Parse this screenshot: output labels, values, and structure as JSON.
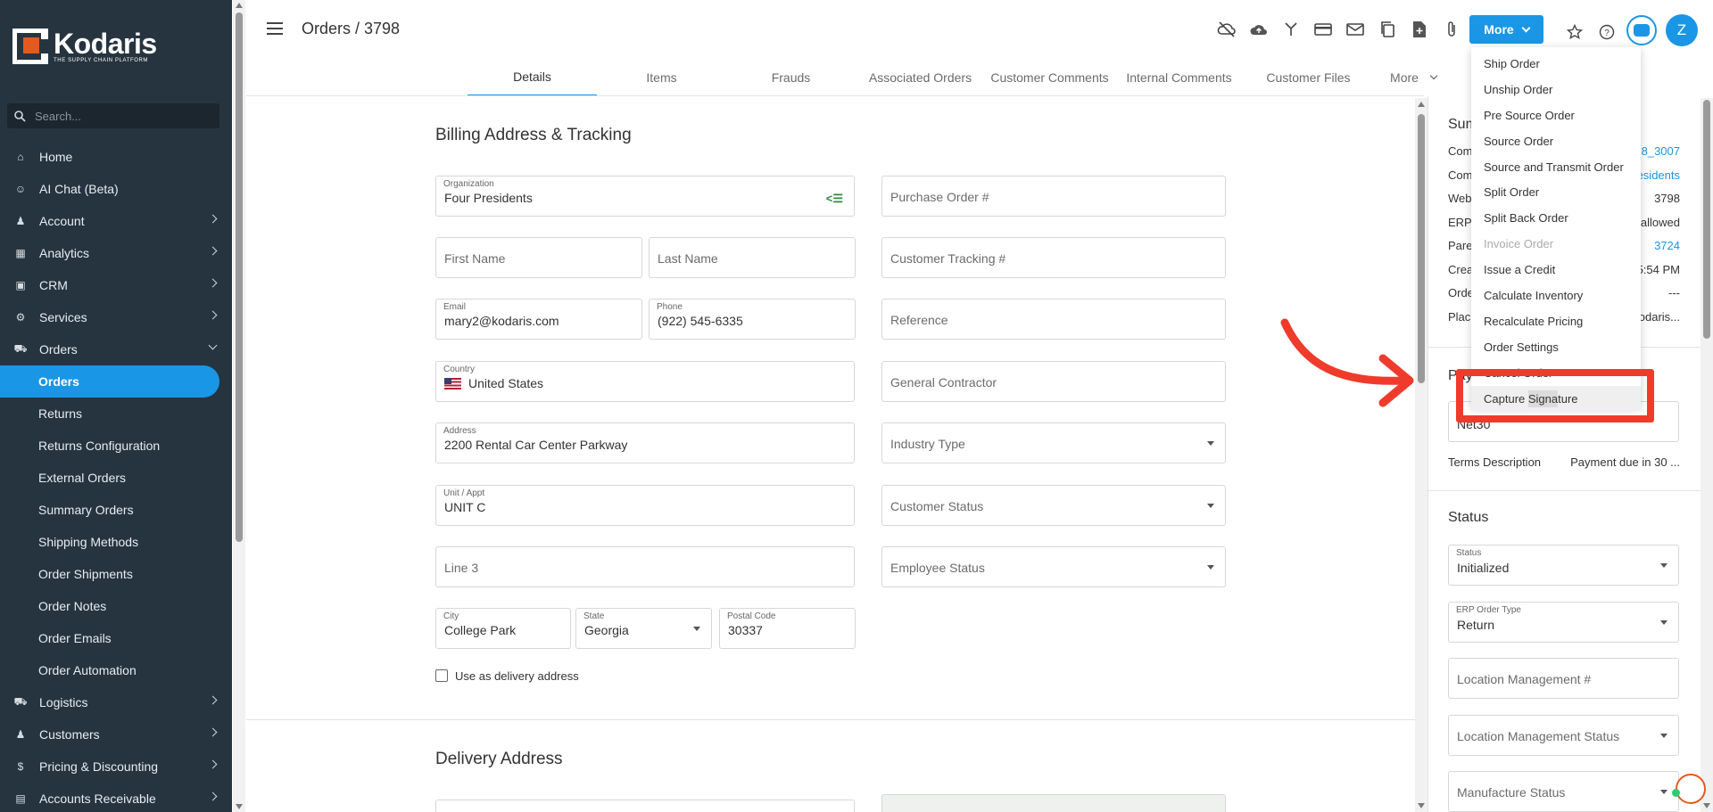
{
  "app": {
    "logo_name": "Kodaris",
    "logo_tagline": "THE SUPPLY CHAIN PLATFORM",
    "search_placeholder": "Search..."
  },
  "sidebar": {
    "items": [
      {
        "label": "Home",
        "icon": "home-icon",
        "glyph": "⌂"
      },
      {
        "label": "AI Chat (Beta)",
        "icon": "robot-icon",
        "glyph": "☺"
      },
      {
        "label": "Account",
        "icon": "person-icon",
        "glyph": "♟"
      },
      {
        "label": "Analytics",
        "icon": "chart-icon",
        "glyph": "▦"
      },
      {
        "label": "CRM",
        "icon": "contact-card-icon",
        "glyph": "▣"
      },
      {
        "label": "Services",
        "icon": "gears-icon",
        "glyph": "⚙"
      },
      {
        "label": "Orders",
        "icon": "truck-icon",
        "glyph": "⛟"
      }
    ],
    "orders_sub": [
      "Orders",
      "Returns",
      "Returns Configuration",
      "External Orders",
      "Summary Orders",
      "Shipping Methods",
      "Order Shipments",
      "Order Notes",
      "Order Emails",
      "Order Automation"
    ],
    "items_after": [
      {
        "label": "Logistics",
        "icon": "truck-fast-icon",
        "glyph": "⛟"
      },
      {
        "label": "Customers",
        "icon": "people-icon",
        "glyph": "♟"
      },
      {
        "label": "Pricing & Discounting",
        "icon": "dollar-icon",
        "glyph": "$"
      },
      {
        "label": "Accounts Receivable",
        "icon": "receivable-icon",
        "glyph": "▤"
      }
    ]
  },
  "header": {
    "title": "Orders / 3798",
    "more_label": "More",
    "avatar_letter": "Z"
  },
  "tabs": [
    "Details",
    "Items",
    "Frauds",
    "Associated Orders",
    "Customer Comments",
    "Internal Comments",
    "Customer Files",
    "More"
  ],
  "billing": {
    "title": "Billing Address & Tracking",
    "organization_label": "Organization",
    "organization": "Four Presidents",
    "first_name_ph": "First Name",
    "last_name_ph": "Last Name",
    "email_label": "Email",
    "email": "mary2@kodaris.com",
    "phone_label": "Phone",
    "phone": "(922) 545-6335",
    "country_label": "Country",
    "country": "United States",
    "address_label": "Address",
    "address": "2200 Rental Car Center Parkway",
    "unit_label": "Unit / Appt",
    "unit": "UNIT C",
    "line3_ph": "Line 3",
    "city_label": "City",
    "city": "College Park",
    "state_label": "State",
    "state": "Georgia",
    "postal_label": "Postal Code",
    "postal": "30337",
    "use_as_delivery": "Use as delivery address",
    "po_ph": "Purchase Order #",
    "tracking_ph": "Customer Tracking #",
    "reference_ph": "Reference",
    "contractor_ph": "General Contractor",
    "industry_ph": "Industry Type",
    "customer_status_ph": "Customer Status",
    "employee_status_ph": "Employee Status"
  },
  "delivery": {
    "title": "Delivery Address"
  },
  "right_panel": {
    "summary_title": "Sum",
    "rows": [
      {
        "k": "Com",
        "v": "8_3007",
        "link": true
      },
      {
        "k": "Com",
        "v": "esidents",
        "link": true
      },
      {
        "k": "Web",
        "v": "3798",
        "link": false
      },
      {
        "k": "ERP",
        "v": "allowed",
        "link": false
      },
      {
        "k": "Pare",
        "v": "3724",
        "link": true
      },
      {
        "k": "Crea",
        "v": "5:54 PM",
        "link": false
      },
      {
        "k": "Orde",
        "v": "---",
        "link": false
      },
      {
        "k": "Plac",
        "v": "odaris...",
        "link": false
      }
    ],
    "payment_title": "Pay",
    "payment_field_val": "Net30",
    "terms_label": "Terms Description",
    "terms_value": "Payment due in 30 ...",
    "status_title": "Status",
    "status_label": "Status",
    "status_value": "Initialized",
    "erp_type_label": "ERP Order Type",
    "erp_type_value": "Return",
    "loc_mgmt_ph": "Location Management #",
    "loc_status_ph": "Location Management Status",
    "mfg_status_ph": "Manufacture Status"
  },
  "more_menu": {
    "items": [
      {
        "label": "Ship Order",
        "disabled": false
      },
      {
        "label": "Unship Order",
        "disabled": false
      },
      {
        "label": "Pre Source Order",
        "disabled": false
      },
      {
        "label": "Source Order",
        "disabled": false
      },
      {
        "label": "Source and Transmit Order",
        "disabled": false
      },
      {
        "label": "Split Order",
        "disabled": false
      },
      {
        "label": "Split Back Order",
        "disabled": false
      },
      {
        "label": "Invoice Order",
        "disabled": true
      },
      {
        "label": "Issue a Credit",
        "disabled": false
      },
      {
        "label": "Calculate Inventory",
        "disabled": false
      },
      {
        "label": "Recalculate Pricing",
        "disabled": false
      },
      {
        "label": "Order Settings",
        "disabled": false
      },
      {
        "label": "Cancel Order",
        "disabled": false
      }
    ],
    "highlight_pre": "Capture ",
    "highlight_mark": "Signa",
    "highlight_post": "ture"
  },
  "colors": {
    "sidebar_bg": "#263440",
    "accent": "#1a96e6",
    "annotation": "#ef3b2c",
    "brand_orange": "#e35a1e"
  }
}
